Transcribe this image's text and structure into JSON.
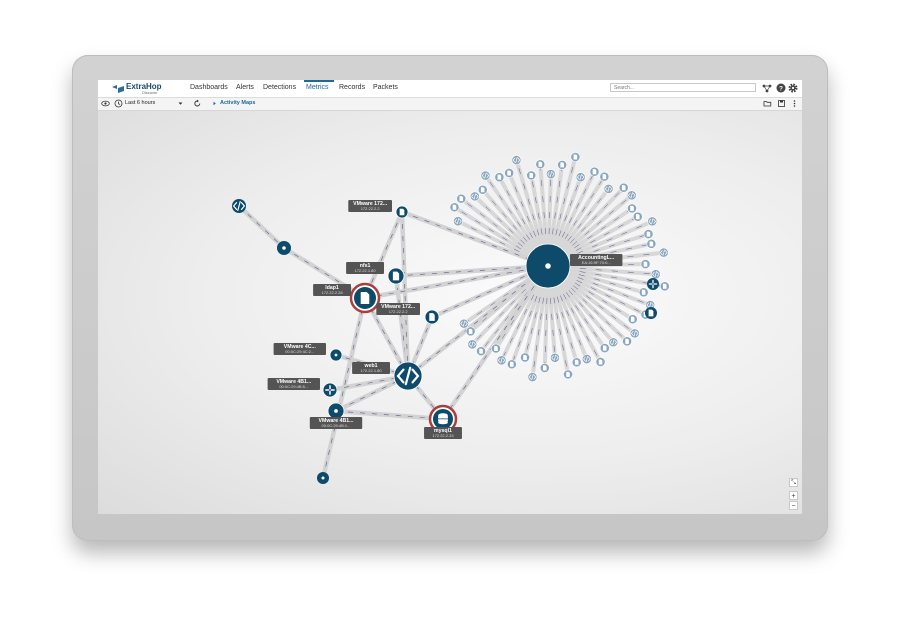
{
  "app": {
    "name": "ExtraHop",
    "product": "Discover"
  },
  "nav": {
    "tabs": [
      {
        "label": "Dashboards"
      },
      {
        "label": "Alerts"
      },
      {
        "label": "Detections"
      },
      {
        "label": "Metrics",
        "active": true
      },
      {
        "label": "Records"
      },
      {
        "label": "Packets"
      }
    ],
    "search_placeholder": "Search..."
  },
  "toolbar": {
    "time_range": "Last 6 hours",
    "breadcrumb": "Activity Maps"
  },
  "colors": {
    "node": "#0e4a6a",
    "halo": "#a93f3c",
    "peer": "#8aa6bd",
    "edge": "#5a5a8c"
  },
  "map": {
    "nodes": [
      {
        "key": "ldap1",
        "icon": "document-icon",
        "label": "ldap1",
        "sub": "172.22.2.28"
      },
      {
        "key": "nfs1",
        "icon": "document-icon",
        "label": "nfs1",
        "sub": "172.22.1.80"
      },
      {
        "key": "vmware172a",
        "icon": "document-icon",
        "label": "VMware 172...",
        "sub": "172.22.2.2"
      },
      {
        "key": "vmware172b",
        "icon": "document-icon",
        "label": "VMware 172...",
        "sub": "172.22.2.2"
      },
      {
        "key": "web1",
        "icon": "code-icon",
        "label": "web1",
        "sub": "172.22.1.80"
      },
      {
        "key": "mysql1",
        "icon": "database-icon",
        "label": "mysql1",
        "sub": "172.22.2.33"
      },
      {
        "key": "vmware4c",
        "icon": "dot-icon",
        "label": "VMware 4C...",
        "sub": "00:0C:29:4C:2..."
      },
      {
        "key": "vmware4b1a",
        "icon": "router-icon",
        "label": "VMware 4B1...",
        "sub": "00:0C:29:4B:5..."
      },
      {
        "key": "vmware4b1b",
        "icon": "dot-icon",
        "label": "VMware 4B1...",
        "sub": "00:0C:29:4B:1..."
      },
      {
        "key": "accounting",
        "icon": "dot-icon",
        "label": "AccountingL...",
        "sub": "EA:16:9F:70:0..."
      }
    ]
  }
}
